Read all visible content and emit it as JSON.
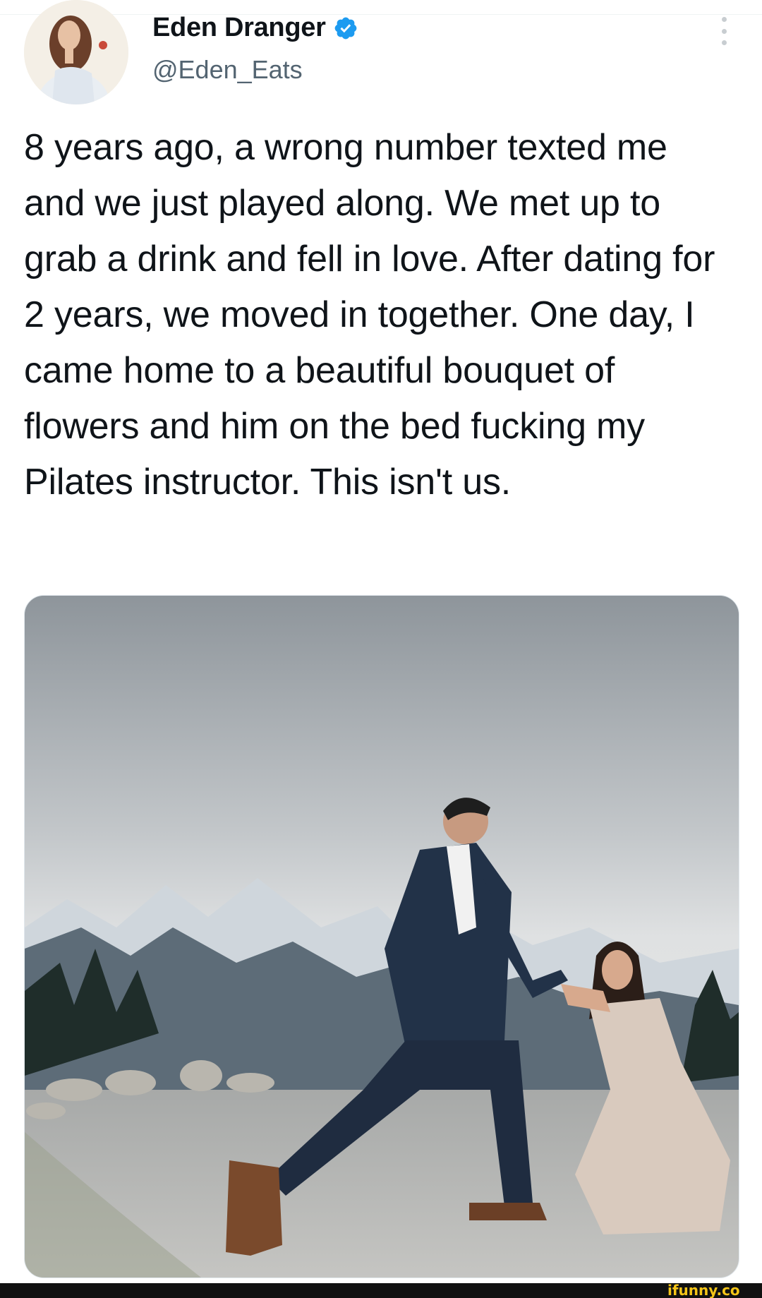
{
  "tweet": {
    "author": {
      "display_name": "Eden Dranger",
      "handle": "@Eden_Eats",
      "verified_icon": "verified-badge-icon",
      "verified_color": "#1d9bf0"
    },
    "text": "8 years ago, a wrong number texted me and we just played along. We met up to grab a drink and fell in love. After dating for 2 years, we moved in together. One day, I came home to a beautiful bouquet of flowers and him on the bed fucking my Pilates instructor. This isn't us.",
    "menu_icon": "more-vertical-icon"
  },
  "media": {
    "kind": "photo"
  },
  "watermark": {
    "text": "ifunny.co",
    "color": "#f5c518"
  }
}
